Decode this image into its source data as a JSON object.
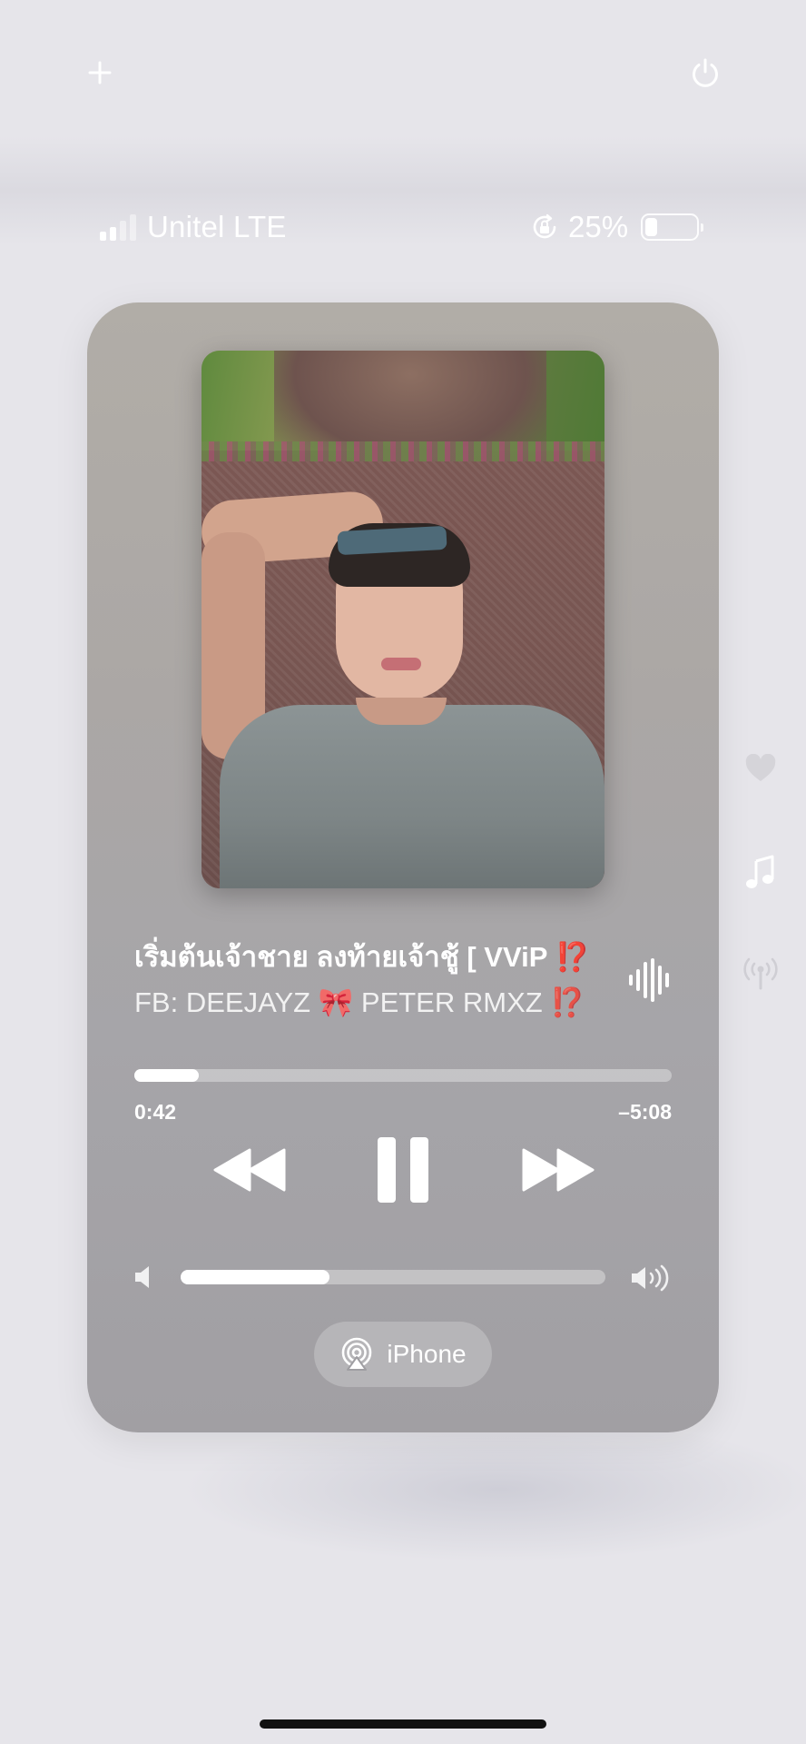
{
  "top_controls": {
    "add_icon": "plus-icon",
    "power_icon": "power-icon"
  },
  "status_bar": {
    "carrier": "Unitel LTE",
    "signal_bars_active": 2,
    "signal_bars_total": 4,
    "battery_percent": "25%",
    "battery_level": 0.25,
    "rotation_lock_icon": "rotation-lock-icon"
  },
  "player": {
    "title_text": "เริ่มต้นเจ้าชาย ลงท้ายเจ้าชู้  [ VViP ",
    "title_mark": "⁉️",
    "artist": "FB: DEEJAYZ 🎀 PETER RMXZ ⁉️",
    "elapsed": "0:42",
    "remaining": "–5:08",
    "progress": 0.12,
    "volume": 0.35,
    "output_device": "iPhone",
    "icons": {
      "waveform": "audio-waveform-icon",
      "rewind": "rewind-icon",
      "pause": "pause-icon",
      "forward": "fast-forward-icon",
      "volume_low": "speaker-low-icon",
      "volume_high": "speaker-high-icon",
      "airplay": "airplay-icon"
    }
  },
  "side_indicators": [
    "heart-icon",
    "music-note-icon",
    "antenna-icon"
  ],
  "colors": {
    "background": "#e6e5ea",
    "card": "#a9a6a6",
    "accent_red": "#d93326"
  }
}
